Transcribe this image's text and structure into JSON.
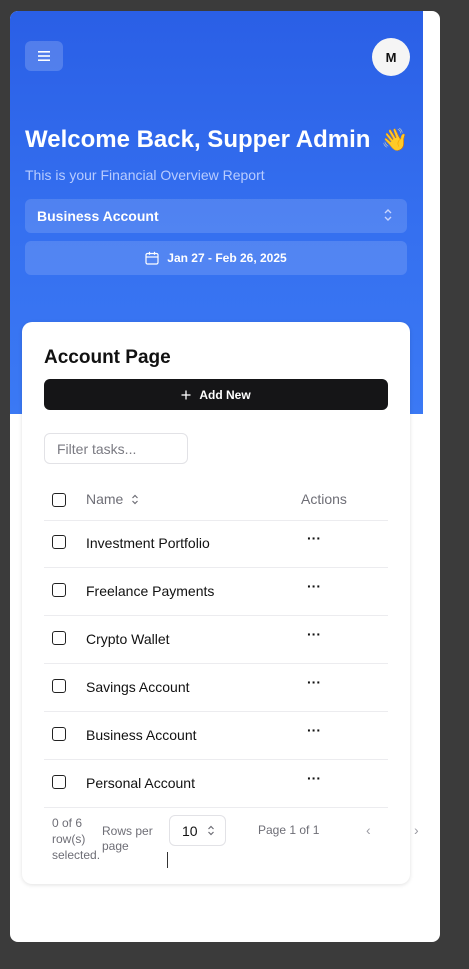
{
  "header": {
    "avatar_initial": "M",
    "welcome": "Welcome Back, Supper Admin",
    "wave_emoji": "👋",
    "subtitle": "This is your Financial Overview Report",
    "account_select": "Business Account",
    "date_range": "Jan 27 - Feb 26, 2025"
  },
  "card": {
    "title": "Account Page",
    "add_label": "Add New",
    "filter_placeholder": "Filter tasks...",
    "columns": {
      "name": "Name",
      "actions": "Actions"
    },
    "rows": [
      {
        "name": "Investment Portfolio",
        "actions": "···"
      },
      {
        "name": "Freelance Payments",
        "actions": "···"
      },
      {
        "name": "Crypto Wallet",
        "actions": "···"
      },
      {
        "name": "Savings Account",
        "actions": "···"
      },
      {
        "name": "Business Account",
        "actions": "···"
      },
      {
        "name": "Personal Account",
        "actions": "···"
      }
    ],
    "footer": {
      "selected": "0 of 6 row(s) selected.",
      "rows_per_page_label": "Rows per page",
      "rows_per_page_value": "10",
      "page_info": "Page 1 of 1",
      "prev": "‹",
      "next": "›"
    }
  },
  "colors": {
    "hero": "#2a5fe6",
    "accent_button": "#151517"
  },
  "icons": [
    "menu-icon",
    "select-chevron-icon",
    "calendar-icon",
    "plus-icon",
    "sort-icon",
    "more-icon"
  ]
}
